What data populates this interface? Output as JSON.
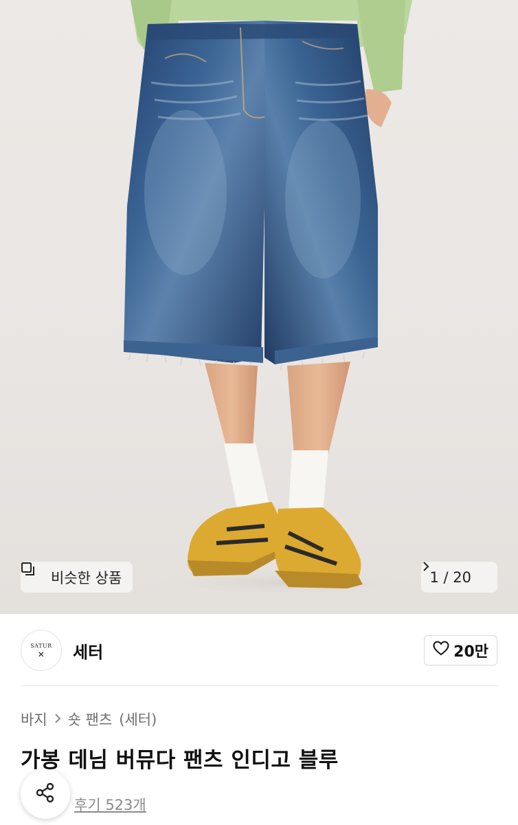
{
  "hero": {
    "image_description_icon": "product-photo-denim-shorts",
    "similar_label": "비슷한 상품",
    "page_counter": "1 / 20"
  },
  "brand": {
    "logo_text": "SATUR",
    "name": "세터",
    "likes": "20만"
  },
  "breadcrumb": {
    "category": "바지",
    "subcategory": "숏 팬츠",
    "brand": "(세터)"
  },
  "product": {
    "title": "가봉 데님 버뮤다 팬츠 인디고 블루",
    "reviews": "후기 523개"
  },
  "colors": {
    "denim": "#2c4a78",
    "sweater": "#b6d39a",
    "shoes": "#d9a62b",
    "background": "#ebe8e5"
  }
}
